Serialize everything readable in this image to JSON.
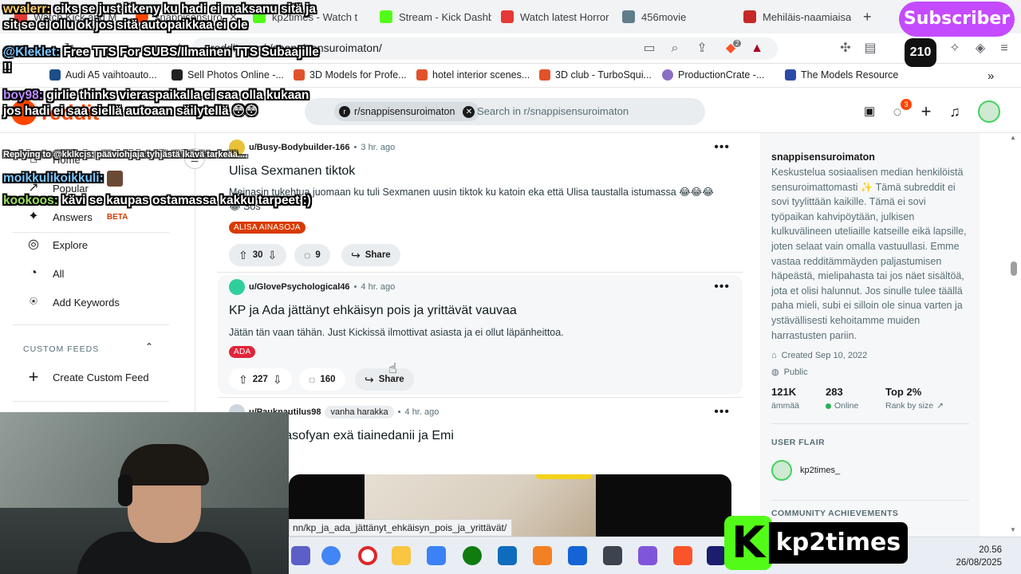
{
  "browser": {
    "tabs": [
      {
        "label": "Watch Kick and M",
        "color": "#e53935"
      },
      {
        "label": "snappisensuro",
        "color": "#ff4500"
      },
      {
        "label": "kp2times - Watch t",
        "color": "#53fc18"
      },
      {
        "label": "Stream - Kick Dashb",
        "color": "#53fc18"
      },
      {
        "label": "Watch latest Horror",
        "color": "#e53935"
      },
      {
        "label": "456movie",
        "color": "#607d8b"
      },
      {
        "label": "Mehiläis-naamiaisa",
        "color": "#c62828"
      }
    ],
    "new_tab": "+",
    "url": "reddit.com/r/snappisensuroimaton/",
    "brave_count": "2",
    "bookmarks": [
      "Audi A5 vaihtoauto...",
      "Sell Photos Online -...",
      "3D Models for Profe...",
      "hotel interior scenes...",
      "3D club - TurboSqui...",
      "ProductionCrate -...",
      "The Models Resource"
    ],
    "bookmarks_more": "»",
    "status_url": "nn/kp_ja_ada_jättänyt_ehkäisyn_pois_ja_yrittävät/"
  },
  "reddit": {
    "logo": "reddit",
    "search_chip": "r/snappisensuroimaton",
    "search_placeholder": "Search in r/snappisensuroimaton",
    "chat_badge": "3",
    "nav": [
      {
        "label": "Home",
        "icon": "home-icon",
        "glyph": "⌂"
      },
      {
        "label": "Popular",
        "icon": "popular-icon",
        "glyph": "↗"
      },
      {
        "label": "Answers",
        "icon": "answers-icon",
        "glyph": "✦",
        "badge": "BETA"
      },
      {
        "label": "Explore",
        "icon": "explore-icon",
        "glyph": "◎"
      },
      {
        "label": "All",
        "icon": "all-icon",
        "glyph": "◔"
      },
      {
        "label": "Add Keywords",
        "icon": "keywords-icon",
        "glyph": "⍟"
      }
    ],
    "custom_feeds_header": "CUSTOM FEEDS",
    "create_custom_feed": "Create Custom Feed",
    "posts": [
      {
        "user": "u/Busy-Bodybuilder-166",
        "time": "3 hr. ago",
        "title": "Ulisa Sexmanen tiktok",
        "body": "Meinasin tukehtua juomaan ku tuli Sexmanen uusin tiktok ku katoin eka että Ulisa taustalla istumassa 😂😂😂 😂 Sos",
        "tag": "ALISA AINASOJA",
        "tag_color": "#d93a00",
        "votes": "30",
        "comments": "9",
        "share": "Share",
        "avatar_color": "#e9c23a"
      },
      {
        "user": "u/GlovePsychological46",
        "time": "4 hr. ago",
        "title": "KP ja Ada jättänyt ehkäisyn pois ja yrittävät vauvaa",
        "body": "Jätän tän vaan tähän. Just Kickissä ilmottivat asiasta ja ei ollut läpänheittoa.",
        "tag": "ADA",
        "tag_color": "#e0243a",
        "votes": "227",
        "comments": "160",
        "share": "Share",
        "avatar_color": "#2fcf9b"
      },
      {
        "user": "u/Pauknautilus98",
        "flair": "vanha harakka",
        "time": "4 hr. ago",
        "title": "Collab: iidasofyan exä tiainedanii ja Emi",
        "tag": "",
        "tag_color": "#e0243a",
        "avatar_color": "#ccd6dc"
      }
    ],
    "sidebar": {
      "name": "snappisensuroimaton",
      "description": "Keskustelua sosiaalisen median henkilöistä sensuroimattomasti ✨ Tämä subreddit ei sovi tyylittään kaikille. Tämä ei sovi työpaikan kahvipöytään, julkisen kulkuvälineen uteliaille katseille eikä lapsille, joten selaat vain omalla vastuullasi. Emme vastaa redditämmäyden paljastumisen häpeästä, mielipahasta tai jos näet sisältöä, jota et olisi halunnut. Jos sinulle tulee täällä paha mieli, subi ei silloin ole sinua varten ja ystävällisesti kehoitamme muiden harrastusten pariin.",
      "created": "Created Sep 10, 2022",
      "visibility": "Public",
      "members": "121K",
      "members_label": "ämmää",
      "online": "283",
      "online_label": "Online",
      "rank": "Top 2%",
      "rank_label": "Rank by size",
      "user_flair_header": "USER FLAIR",
      "user_flair": "kp2times_",
      "achievements_header": "COMMUNITY ACHIEVEMENTS"
    }
  },
  "overlay": {
    "chat": [
      {
        "name": "wvalerr:",
        "text": "eiks se just itkeny ku hadi ei maksanu sitä ja sit se ei ollu ok jos sitä autopaikkaa ei ole"
      },
      {
        "name": "@Kleklet:",
        "text": "Free TTS For SUBS/Ilmainen TTS Subaajille !!"
      },
      {
        "name": "boy98:",
        "text": "girlie thinks vieraspaikalla ei saa olla kukaan jos hadi ei saa siellä autoaan säilytellä 😳😳"
      },
      {
        "name": "Replying to @kklkcjs:",
        "text": "pääviohjaja tyhjästä ikävä tarkeää...."
      },
      {
        "name": "moikkulikoikkuli:",
        "text": ""
      },
      {
        "name": "kookoos:",
        "text": "kävi se kaupas ostamassa kakku tarpeet :)"
      }
    ],
    "subscriber_banner": "Subscriber",
    "sub_count": "210",
    "kick_badge": "kp2times",
    "kick_k": "K"
  },
  "taskbar": {
    "time": "20.56",
    "date": "26/08/2025"
  }
}
